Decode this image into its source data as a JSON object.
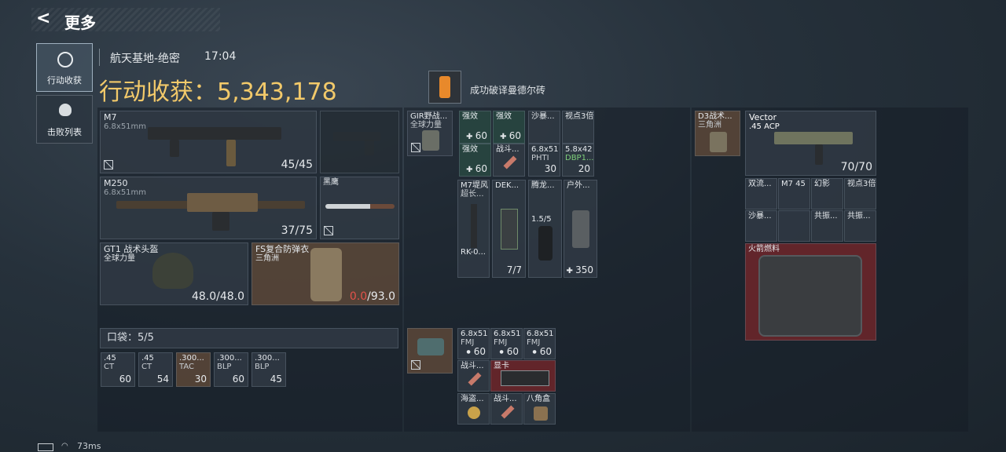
{
  "header": {
    "back_label": "更多"
  },
  "tabs": [
    {
      "label": "行动收获"
    },
    {
      "label": "击败列表"
    }
  ],
  "map": {
    "name": "航天基地-绝密",
    "time": "17:04"
  },
  "summary": {
    "title": "行动收获：",
    "value": "5,343,178"
  },
  "achievement": {
    "text": "成功破译曼德尔砖"
  },
  "equipment": {
    "m7": {
      "name": "M7",
      "sub": "6.8x51mm",
      "count": "45/45"
    },
    "m250": {
      "name": "M250",
      "sub": "6.8x51mm",
      "count": "37/75"
    },
    "knife": {
      "name": "黑鹰"
    },
    "helmet": {
      "name": "GT1 战术头盔",
      "sub": "全球力量",
      "durability": "48.0/48.0"
    },
    "armor": {
      "name": "FS复合防弹衣",
      "sub": "三角洲",
      "durability_cur": "0.0",
      "durability_max": "/93.0"
    }
  },
  "pocket": {
    "label": "口袋：",
    "count": "5/5",
    "items": [
      {
        "name": ".45",
        "name2": "CT",
        "count": "60"
      },
      {
        "name": ".45",
        "name2": "CT",
        "count": "54"
      },
      {
        "name": ".300...",
        "name2": "TAC",
        "count": "30"
      },
      {
        "name": ".300...",
        "name2": "BLP",
        "count": "60"
      },
      {
        "name": ".300...",
        "name2": "BLP",
        "count": "45"
      }
    ]
  },
  "chest_rig": {
    "name": "GIR野战...",
    "sub": "全球力量",
    "items": [
      {
        "name": "强效",
        "count": "60"
      },
      {
        "name": "强效",
        "count": "60"
      },
      {
        "name": "强效",
        "count": "60"
      },
      {
        "name": "战斗...",
        "count": ""
      },
      {
        "name": "沙暴...",
        "count": ""
      },
      {
        "name": "视点3倍",
        "count": ""
      },
      {
        "name": "6.8x51",
        "name2": "PHTI",
        "count": "30"
      },
      {
        "name": "5.8x42",
        "name2": "DBP1...",
        "count": "20"
      }
    ],
    "tall_items": [
      {
        "name": "M7堤风",
        "name2": "超长...",
        "bottom": "RK-0..."
      },
      {
        "name": "DEK...",
        "count": "7/7"
      },
      {
        "name": "腾龙...",
        "name2": "1.5/5"
      },
      {
        "name": "户外...",
        "count": "350"
      }
    ]
  },
  "backpack": {
    "items": [
      {
        "name": "6.8x51",
        "name2": "FMJ",
        "count": "60"
      },
      {
        "name": "6.8x51",
        "name2": "FMJ",
        "count": "60"
      },
      {
        "name": "6.8x51",
        "name2": "FMJ",
        "count": "60"
      },
      {
        "name": "战斗..."
      },
      {
        "name": "显卡"
      },
      {
        "name": "海盗..."
      },
      {
        "name": "战斗..."
      },
      {
        "name": "八角盒"
      }
    ]
  },
  "safe_box": {
    "item": {
      "name": "D3战术...",
      "name2": "三角洲"
    },
    "vector": {
      "name": "Vector",
      "sub": ".45 ACP",
      "count": "70/70"
    },
    "attachments": [
      {
        "name": "双流..."
      },
      {
        "name": "M7 45"
      },
      {
        "name": "幻影"
      },
      {
        "name": "视点3倍"
      },
      {
        "name": "沙暴..."
      },
      {
        "name": ""
      },
      {
        "name": "共振..."
      },
      {
        "name": "共振..."
      }
    ],
    "fuel": {
      "name": "火箭燃料"
    }
  },
  "status": {
    "ping": "73ms"
  }
}
